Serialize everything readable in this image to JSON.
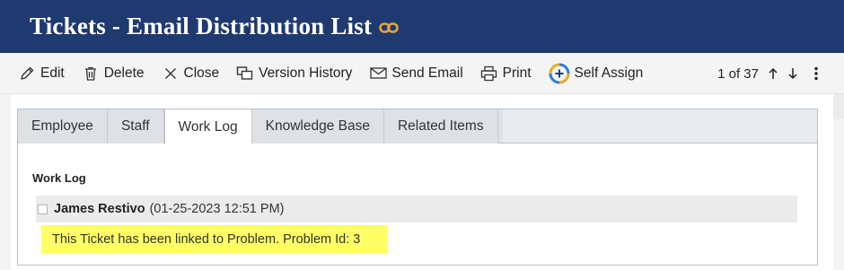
{
  "header": {
    "title": "Tickets - Email Distribution List",
    "link_icon": "link-icon",
    "background": "#1f3a6e",
    "link_color": "#e8a33d"
  },
  "toolbar": {
    "items": [
      {
        "label": "Edit",
        "icon": "pencil-icon"
      },
      {
        "label": "Delete",
        "icon": "trash-icon"
      },
      {
        "label": "Close",
        "icon": "close-icon"
      },
      {
        "label": "Version History",
        "icon": "version-history-icon"
      },
      {
        "label": "Send Email",
        "icon": "envelope-icon"
      },
      {
        "label": "Print",
        "icon": "printer-icon"
      },
      {
        "label": "Self Assign",
        "icon": "self-assign-icon"
      }
    ],
    "pager": "1 of 37",
    "up_icon": "arrow-up-icon",
    "down_icon": "arrow-down-icon",
    "more_icon": "more-vertical-icon"
  },
  "tabs": [
    {
      "label": "Employee",
      "active": false
    },
    {
      "label": "Staff",
      "active": false
    },
    {
      "label": "Work Log",
      "active": true
    },
    {
      "label": "Knowledge Base",
      "active": false
    },
    {
      "label": "Related Items",
      "active": false
    }
  ],
  "worklog": {
    "section_label": "Work Log",
    "entries": [
      {
        "author": "James Restivo",
        "timestamp": "(01-25-2023 12:51 PM)",
        "message": "This Ticket has been linked to Problem. Problem Id: 3",
        "highlight_color": "#ffff66"
      }
    ]
  }
}
